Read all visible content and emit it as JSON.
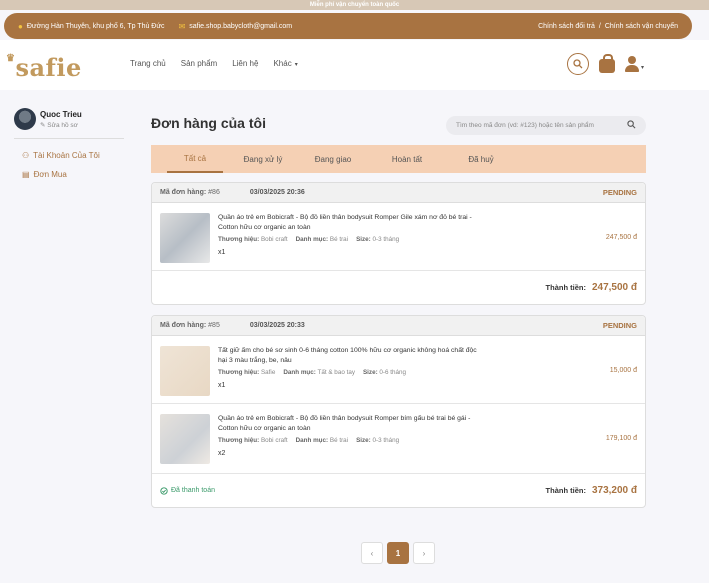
{
  "promo": "Miễn phí vận chuyển toàn quốc",
  "topbar": {
    "address": "Đường Hàn Thuyên, khu phố 6, Tp Thủ Đức",
    "email": "safie.shop.babycloth@gmail.com",
    "policy_return": "Chính sách đổi trả",
    "separator": "/",
    "policy_shipping": "Chính sách vận chuyển"
  },
  "header": {
    "logo": "safie",
    "nav": [
      "Trang chủ",
      "Sản phẩm",
      "Liên hệ",
      "Khác"
    ]
  },
  "sidebar": {
    "name": "Quoc Trieu",
    "edit": "Sửa hồ sơ",
    "account": "Tài Khoản Của Tôi",
    "orders": "Đơn Mua"
  },
  "main": {
    "title": "Đơn hàng của tôi",
    "search_placeholder": "Tìm theo mã đơn (vd: #123) hoặc tên sản phẩm",
    "tabs": [
      "Tất cả",
      "Đang xử lý",
      "Đang giao",
      "Hoàn tất",
      "Đã huỷ"
    ]
  },
  "labels": {
    "order_code": "Mã đơn hàng:",
    "brand": "Thương hiệu:",
    "category": "Danh mục:",
    "size": "Size:",
    "total": "Thành tiền:"
  },
  "orders": [
    {
      "code": "#86",
      "date": "03/03/2025 20:36",
      "status": "PENDING",
      "items": [
        {
          "name": "Quần áo trẻ em Bobicraft - Bộ đồ liền thân bodysuit Romper Gile xám nơ đỏ bé trai - Cotton hữu cơ organic an toàn",
          "brand": "Bobi craft",
          "category": "Bé trai",
          "size": "0-3 tháng",
          "qty": "x1",
          "price": "247,500 đ"
        }
      ],
      "total": "247,500 đ"
    },
    {
      "code": "#85",
      "date": "03/03/2025 20:33",
      "status": "PENDING",
      "items": [
        {
          "name": "Tất giữ ấm cho bé sơ sinh 0-6 tháng cotton 100% hữu cơ organic không hoá chất độc hại 3 màu trắng, be, nâu",
          "brand": "Safie",
          "category": "Tất & bao tay",
          "size": "0-6 tháng",
          "qty": "x1",
          "price": "15,000 đ"
        },
        {
          "name": "Quần áo trẻ em Bobicraft - Bộ đồ liền thân bodysuit Romper bím gấu bé trai bé gái - Cotton hữu cơ organic an toàn",
          "brand": "Bobi craft",
          "category": "Bé trai",
          "size": "0-3 tháng",
          "qty": "x2",
          "price": "179,100 đ"
        }
      ],
      "paid_label": "Đã thanh toán",
      "total": "373,200 đ"
    }
  ],
  "pager": {
    "prev": "‹",
    "current": "1",
    "next": "›"
  },
  "colors": {
    "brand": "#a87341",
    "tab_bg": "#f5d0b4",
    "paid": "#3a9a6a"
  }
}
